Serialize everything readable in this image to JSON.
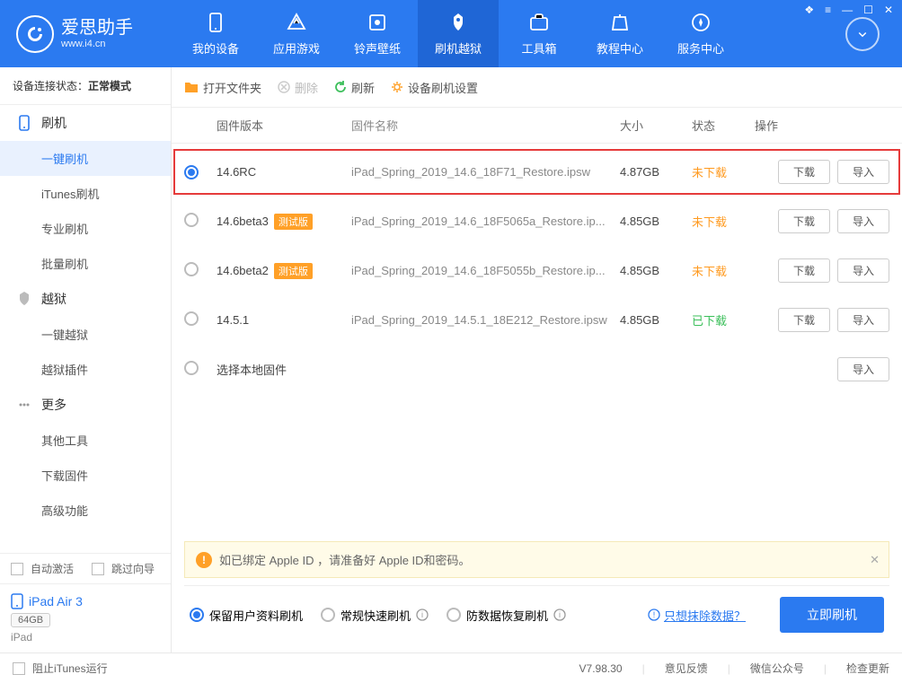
{
  "app": {
    "title": "爱思助手",
    "subtitle": "www.i4.cn"
  },
  "nav": [
    {
      "label": "我的设备"
    },
    {
      "label": "应用游戏"
    },
    {
      "label": "铃声壁纸"
    },
    {
      "label": "刷机越狱",
      "active": true
    },
    {
      "label": "工具箱"
    },
    {
      "label": "教程中心"
    },
    {
      "label": "服务中心"
    }
  ],
  "conn": {
    "label": "设备连接状态：",
    "value": "正常模式"
  },
  "sidebar": {
    "groups": [
      {
        "title": "刷机",
        "items": [
          {
            "label": "一键刷机",
            "active": true
          },
          {
            "label": "iTunes刷机"
          },
          {
            "label": "专业刷机"
          },
          {
            "label": "批量刷机"
          }
        ]
      },
      {
        "title": "越狱",
        "items": [
          {
            "label": "一键越狱"
          },
          {
            "label": "越狱插件"
          }
        ]
      },
      {
        "title": "更多",
        "items": [
          {
            "label": "其他工具"
          },
          {
            "label": "下载固件"
          },
          {
            "label": "高级功能"
          }
        ]
      }
    ]
  },
  "checkboxes": {
    "autoActivate": "自动激活",
    "skipWizard": "跳过向导",
    "blockItunes": "阻止iTunes运行"
  },
  "device": {
    "name": "iPad Air 3",
    "capacity": "64GB",
    "model": "iPad"
  },
  "toolbar": {
    "openFolder": "打开文件夹",
    "delete": "删除",
    "refresh": "刷新",
    "settings": "设备刷机设置"
  },
  "table": {
    "headers": {
      "version": "固件版本",
      "name": "固件名称",
      "size": "大小",
      "status": "状态",
      "action": "操作"
    },
    "rows": [
      {
        "selected": true,
        "highlight": true,
        "version": "14.6RC",
        "badge": "",
        "name": "iPad_Spring_2019_14.6_18F71_Restore.ipsw",
        "size": "4.87GB",
        "status": "未下载",
        "statusClass": "no",
        "actions": [
          "下载",
          "导入"
        ]
      },
      {
        "version": "14.6beta3",
        "badge": "测试版",
        "name": "iPad_Spring_2019_14.6_18F5065a_Restore.ip...",
        "size": "4.85GB",
        "status": "未下载",
        "statusClass": "no",
        "actions": [
          "下载",
          "导入"
        ]
      },
      {
        "version": "14.6beta2",
        "badge": "测试版",
        "name": "iPad_Spring_2019_14.6_18F5055b_Restore.ip...",
        "size": "4.85GB",
        "status": "未下载",
        "statusClass": "no",
        "actions": [
          "下载",
          "导入"
        ]
      },
      {
        "version": "14.5.1",
        "badge": "",
        "name": "iPad_Spring_2019_14.5.1_18E212_Restore.ipsw",
        "size": "4.85GB",
        "status": "已下载",
        "statusClass": "yes",
        "actions": [
          "下载",
          "导入"
        ]
      },
      {
        "version": "选择本地固件",
        "badge": "",
        "name": "",
        "size": "",
        "status": "",
        "statusClass": "",
        "actions": [
          "导入"
        ]
      }
    ]
  },
  "banner": {
    "text": "如已绑定 Apple ID ，请准备好 Apple ID和密码。"
  },
  "flashOptions": {
    "opts": [
      {
        "label": "保留用户资料刷机",
        "checked": true,
        "info": false
      },
      {
        "label": "常规快速刷机",
        "checked": false,
        "info": true
      },
      {
        "label": "防数据恢复刷机",
        "checked": false,
        "info": true
      }
    ],
    "link": "只想抹除数据？",
    "button": "立即刷机"
  },
  "statusbar": {
    "version": "V7.98.30",
    "items": [
      "意见反馈",
      "微信公众号",
      "检查更新"
    ]
  }
}
